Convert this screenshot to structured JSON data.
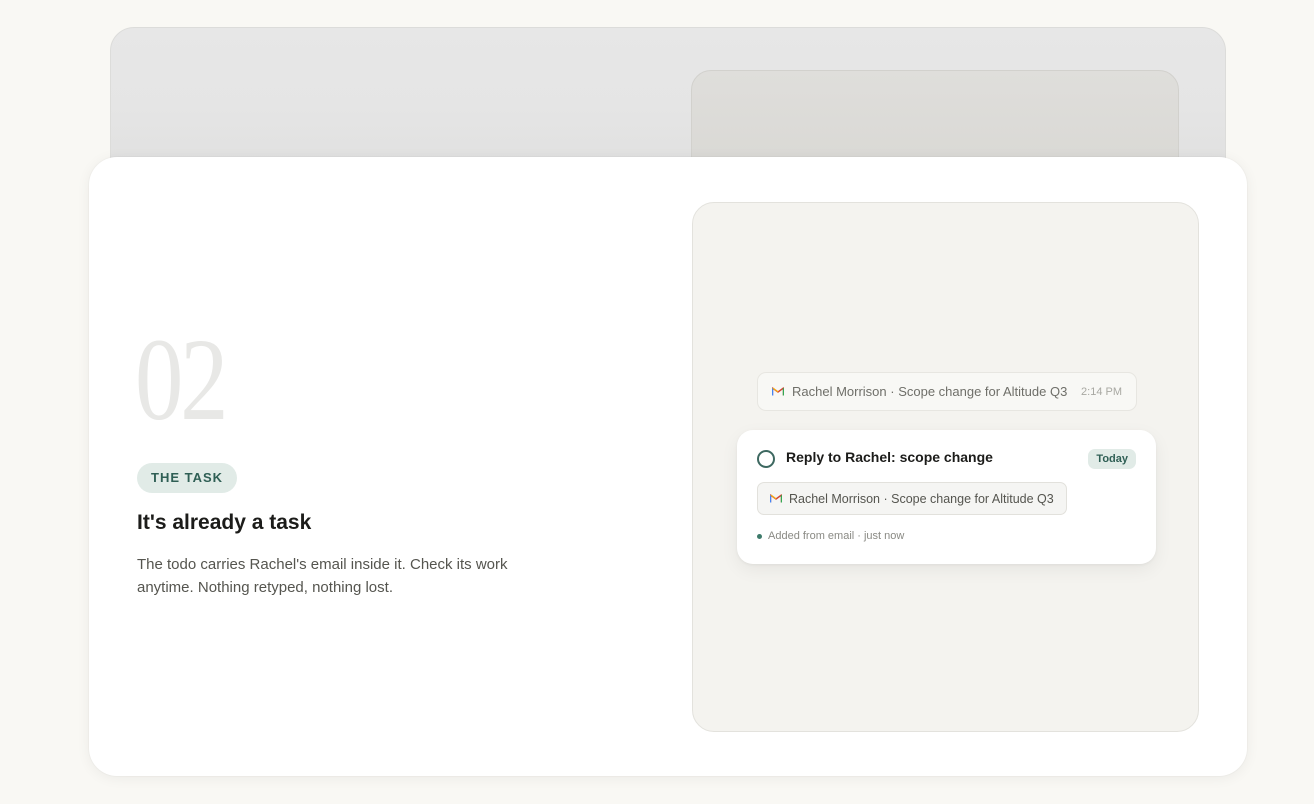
{
  "step": {
    "number": "02",
    "tag": "THE TASK",
    "heading": "It's already a task",
    "description": "The todo carries Rachel's email inside it. Check its work anytime. Nothing retyped, nothing lost."
  },
  "email": {
    "icon": "gmail-icon",
    "subject": "Rachel Morrison · Scope change for Altitude Q3",
    "time": "2:14 PM"
  },
  "task": {
    "title": "Reply to Rachel: scope change",
    "due": "Today",
    "attachment": "Rachel Morrison · Scope change for Altitude Q3",
    "source_note": "Added from email · just now"
  },
  "colors": {
    "accent": "#2f5f55",
    "accent_bg": "#e1ebe7",
    "background": "#f9f8f4"
  }
}
